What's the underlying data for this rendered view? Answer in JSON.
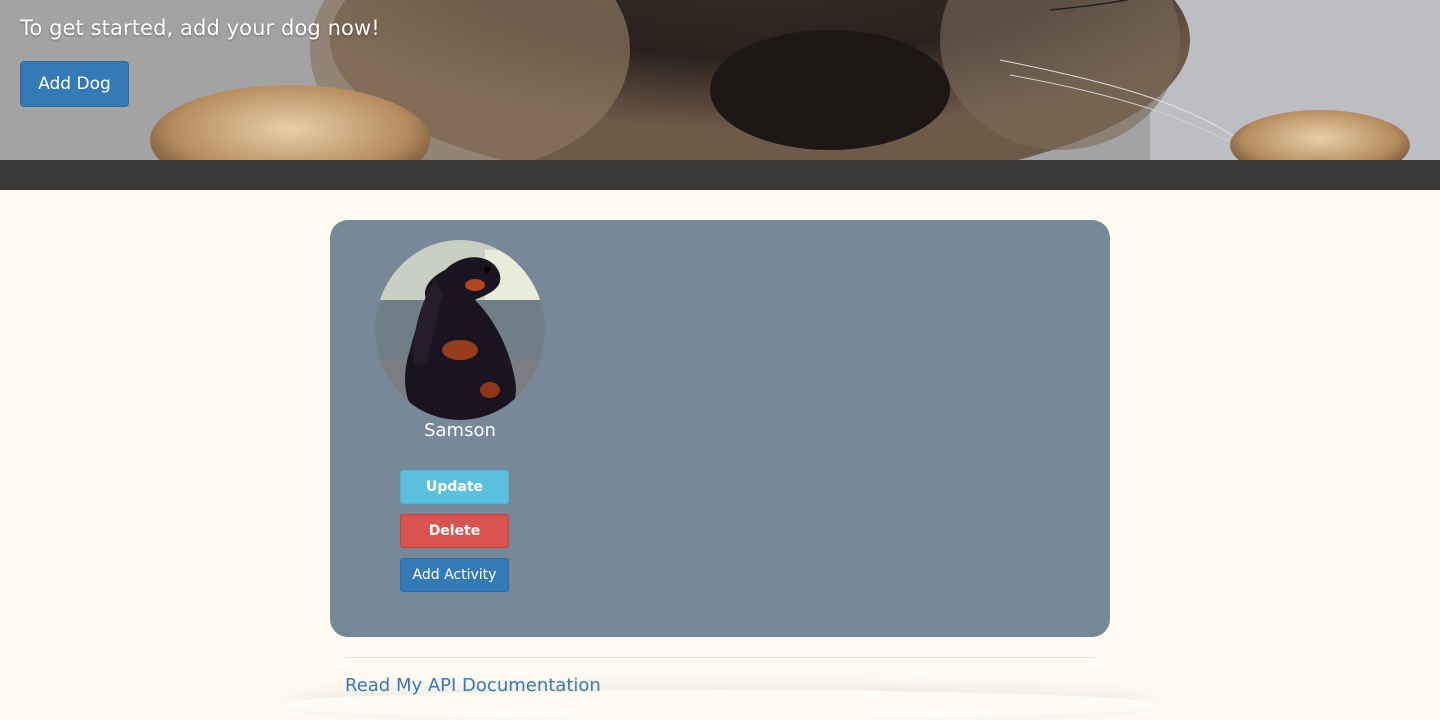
{
  "hero": {
    "prompt": "To get started, add your dog now!",
    "add_dog_label": "Add Dog"
  },
  "dog_card": {
    "name": "Samson",
    "update_label": "Update",
    "delete_label": "Delete",
    "add_activity_label": "Add Activity"
  },
  "footer": {
    "docs_link": "Read My API Documentation"
  },
  "colors": {
    "page_background": "#fffbf3",
    "card_background": "#778899",
    "primary": "#337ab7",
    "info": "#5bc0de",
    "danger": "#d9534f"
  }
}
